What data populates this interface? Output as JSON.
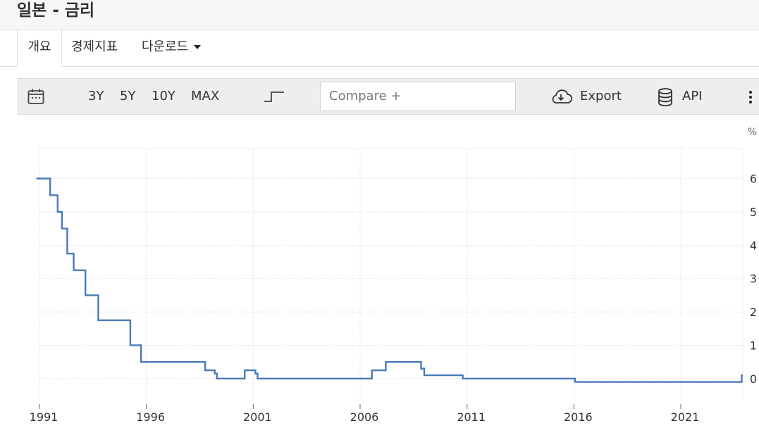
{
  "header": {
    "title": "일본 - 금리"
  },
  "tabs": [
    {
      "label": "개요",
      "active": true
    },
    {
      "label": "경제지표",
      "active": false
    },
    {
      "label": "다운로드",
      "active": false
    }
  ],
  "toolbar": {
    "ranges": [
      "3Y",
      "5Y",
      "10Y",
      "MAX"
    ],
    "compare_placeholder": "Compare +",
    "export_label": "Export",
    "api_label": "API"
  },
  "colors": {
    "line": "#4a7ab8",
    "grid": "#e4e4e4",
    "toolbar_bg": "#eeeeee"
  },
  "chart_data": {
    "type": "line",
    "step": true,
    "unit_label": "%",
    "x_ticks": [
      "1991",
      "1996",
      "2001",
      "2006",
      "2011",
      "2016",
      "2021"
    ],
    "y_ticks": [
      "0",
      "1",
      "2",
      "3",
      "4",
      "5",
      "6"
    ],
    "xlim": [
      1991,
      2023.9
    ],
    "ylim": [
      -0.7,
      6.9
    ],
    "series": [
      {
        "x": [
          1990.85,
          1991.5,
          1991.85,
          1992.05,
          1992.3,
          1992.6,
          1993.15,
          1993.75,
          1995.25,
          1995.75,
          1998.75,
          1999.2,
          1999.3,
          2000.6,
          2001.1,
          2001.2,
          2006.55,
          2007.2,
          2008.85,
          2009.0,
          2010.8,
          2016.05,
          2023.85,
          2023.9
        ],
        "y": [
          6,
          5.5,
          5,
          4.5,
          3.75,
          3.25,
          2.5,
          1.75,
          1,
          0.5,
          0.25,
          0.15,
          0,
          0.25,
          0.15,
          0,
          0.25,
          0.5,
          0.3,
          0.1,
          0,
          -0.1,
          0.1,
          0.1
        ]
      }
    ]
  }
}
